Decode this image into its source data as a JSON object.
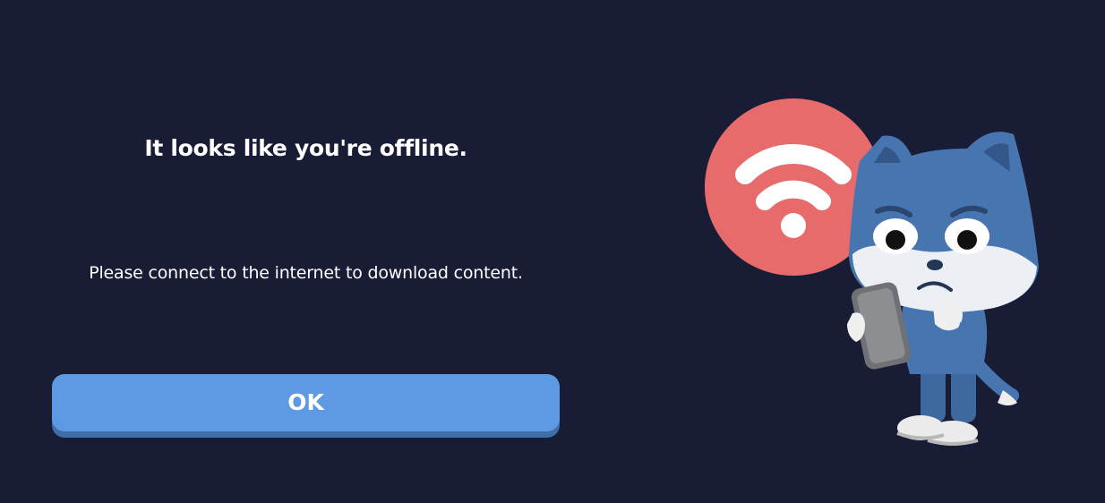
{
  "dialog": {
    "title": "It looks like you're offline.",
    "message": "Please connect to the internet to download content.",
    "ok_label": "OK"
  },
  "illustration": {
    "icon": "wifi-icon",
    "character": "cat-with-phone",
    "badge_color": "#e86b6b",
    "cat_color": "#4675b0"
  },
  "colors": {
    "background": "#181c35",
    "button": "#5e99e4",
    "button_shadow": "#3f6ea8",
    "text": "#ffffff"
  }
}
